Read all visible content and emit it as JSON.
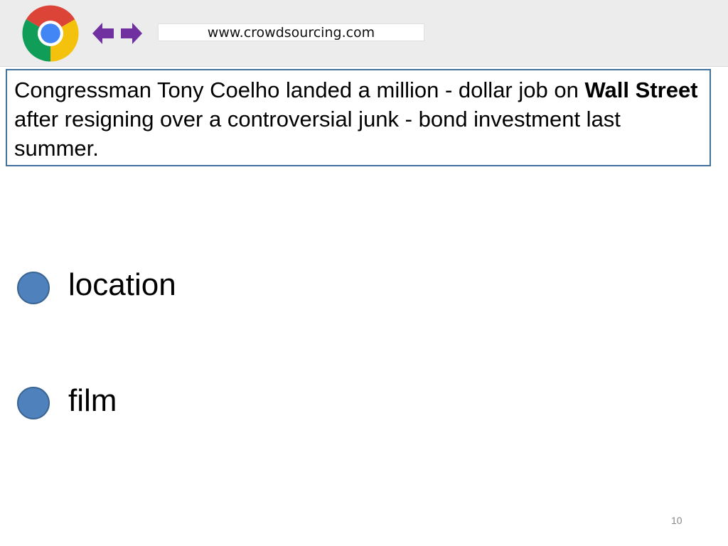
{
  "browser": {
    "logo_icon": "chrome-logo-icon",
    "back_icon": "arrow-left-icon",
    "forward_icon": "arrow-right-icon",
    "arrow_color": "#7030a0",
    "url": "www.crowdsourcing.com"
  },
  "question": {
    "part1": "Congressman Tony Coelho landed a million - dollar job on ",
    "bold": "Wall Street",
    "part2": " after resigning over a controversial junk - bond investment last summer.",
    "border_color": "#41719c"
  },
  "options": [
    {
      "label": "location"
    },
    {
      "label": "film"
    }
  ],
  "option_color": "#4f81bd",
  "page_number": "10"
}
